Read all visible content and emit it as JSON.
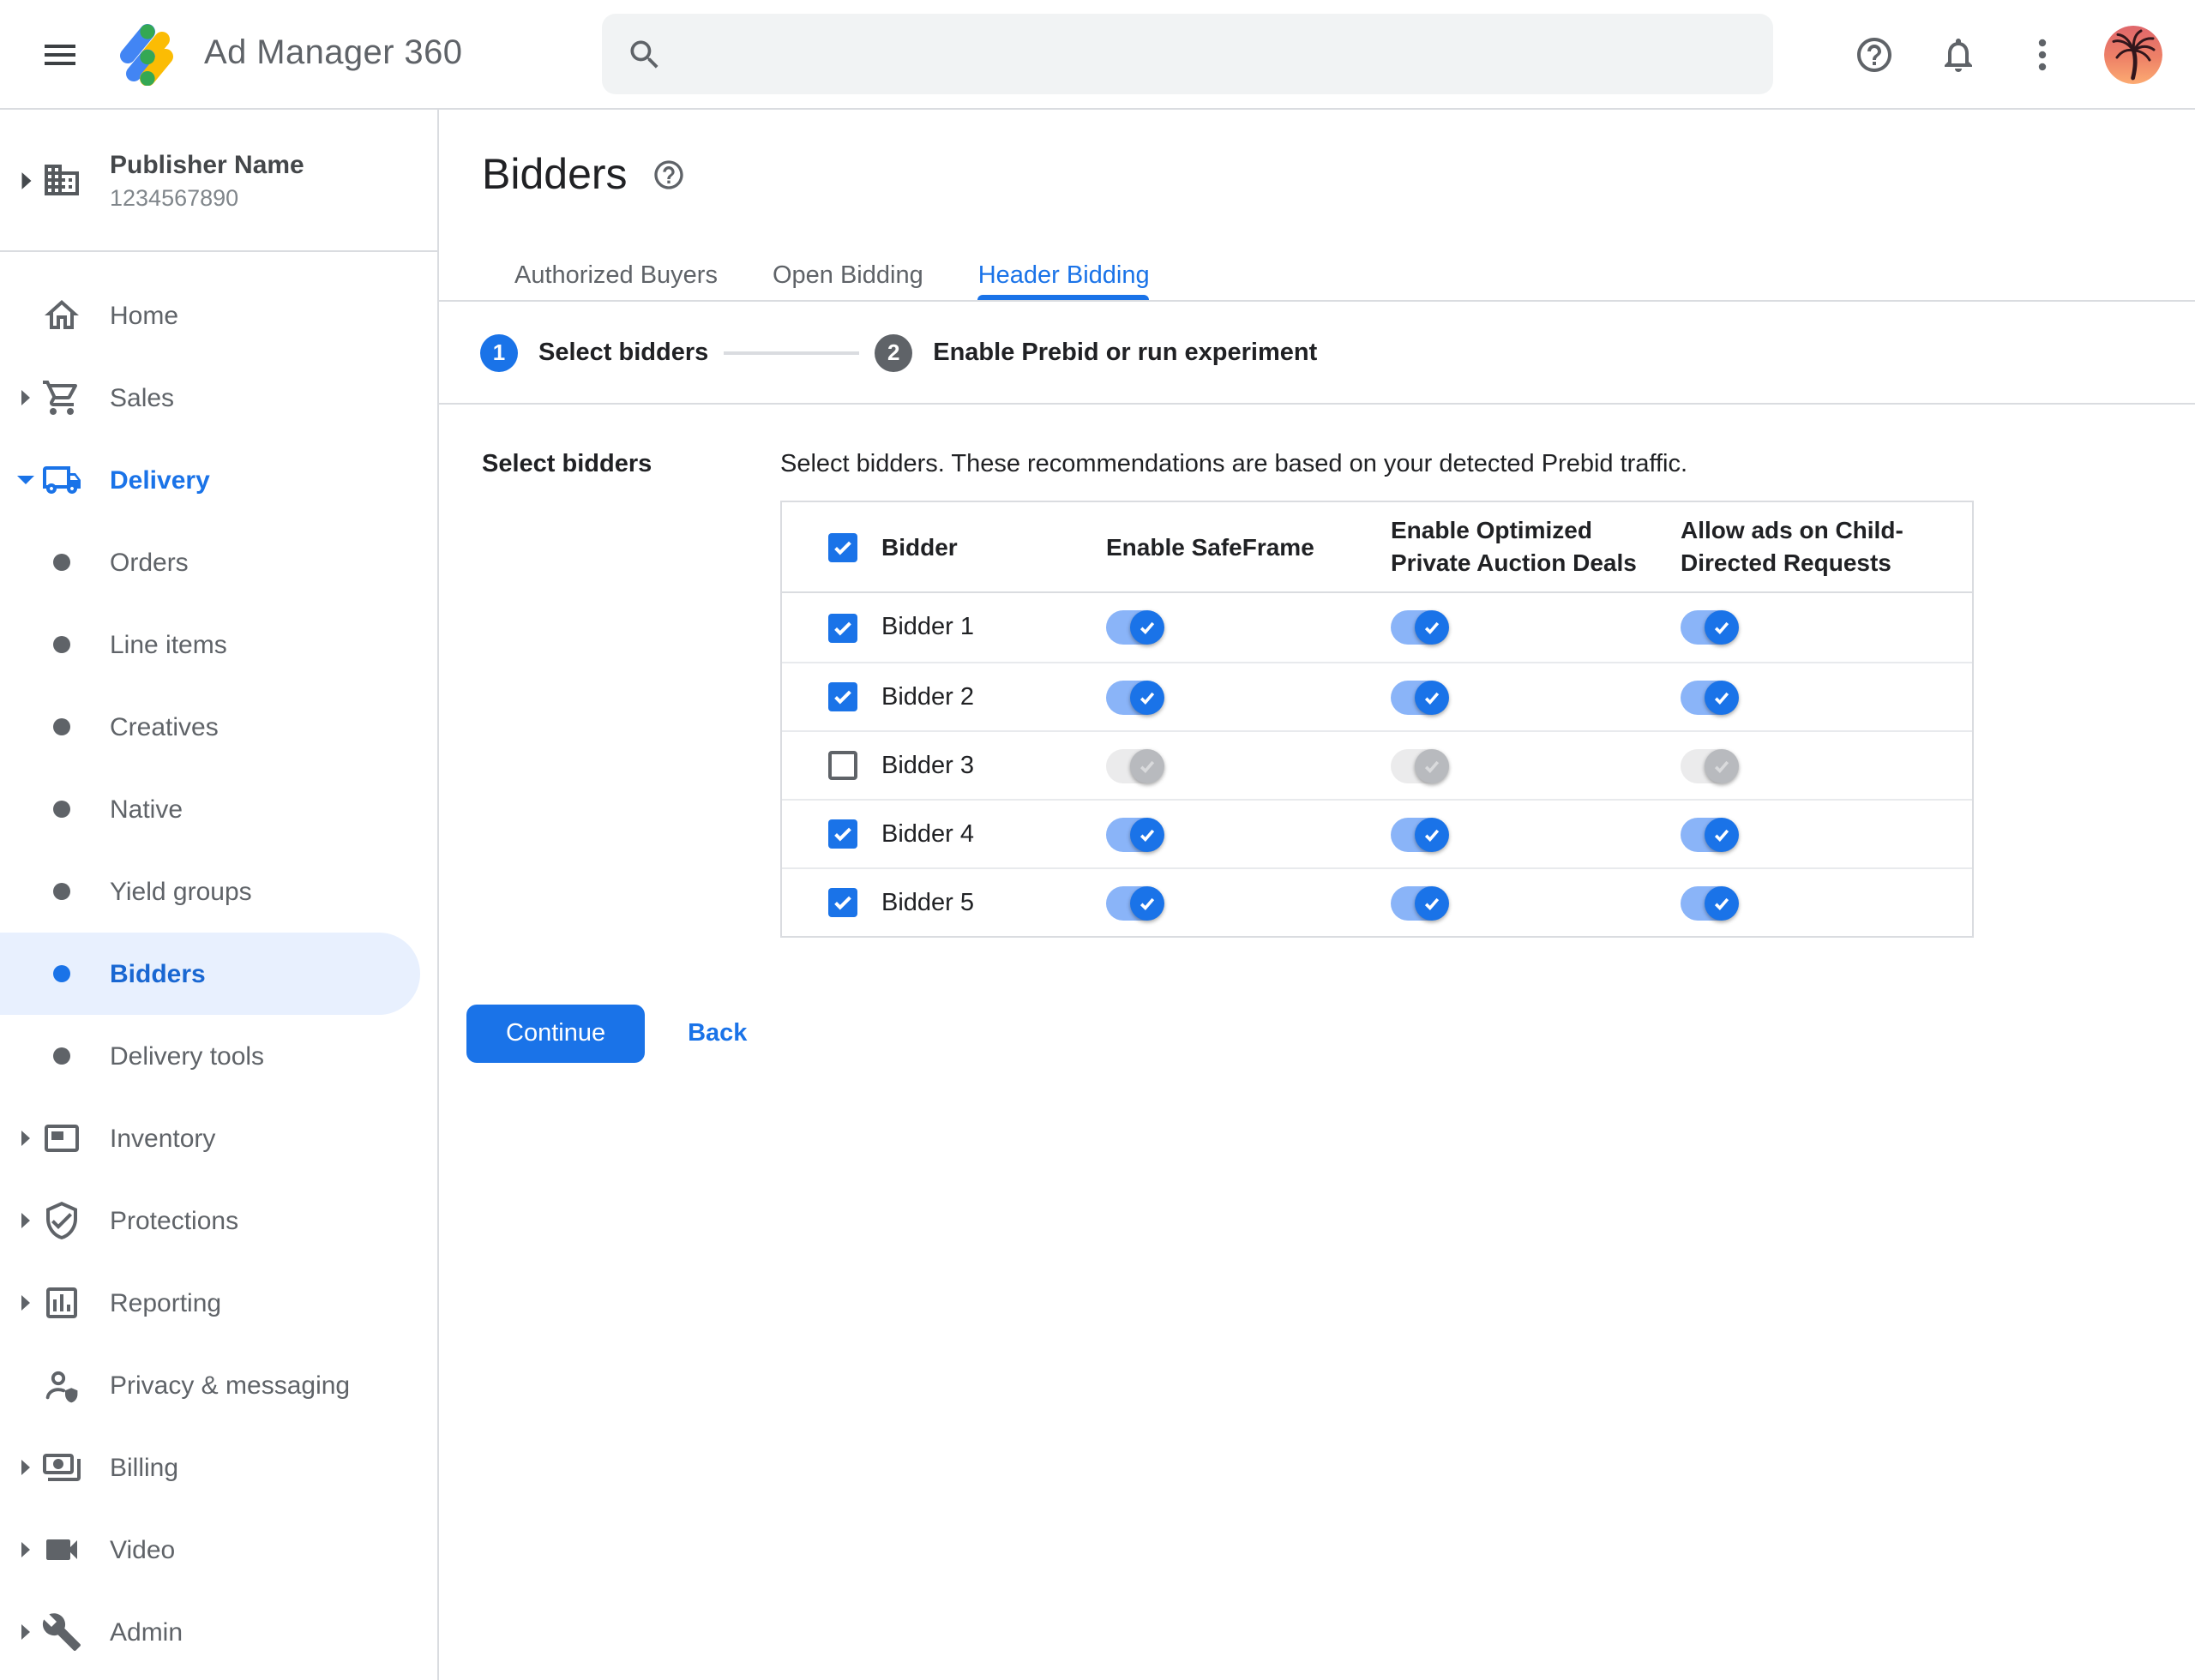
{
  "colors": {
    "accent_blue": "#1a73e8",
    "selected_nav_text": "#1967d2",
    "selected_nav_bg": "#e8f0fe",
    "toggle_on_track": "#8ab4f8",
    "toggle_on_thumb": "#1a73e8",
    "toggle_off_track": "#ebebec",
    "toggle_off_thumb": "#b8babe",
    "divider": "#dadce0",
    "text_primary": "#202124",
    "text_secondary": "#5f6368",
    "logo_blue": "#4285f4",
    "logo_yellow": "#fbbc04",
    "logo_green": "#34a853"
  },
  "header": {
    "brand": "Ad Manager 360",
    "search_placeholder": "",
    "icons": [
      "menu-icon",
      "search-icon",
      "help-icon",
      "notifications-icon",
      "more-vert-icon",
      "avatar"
    ]
  },
  "sidebar": {
    "publisher_name": "Publisher Name",
    "publisher_id": "1234567890",
    "items": [
      {
        "label": "Home",
        "icon": "home-icon"
      },
      {
        "label": "Sales",
        "icon": "cart-icon"
      },
      {
        "label": "Delivery",
        "icon": "truck-icon"
      },
      {
        "label": "Orders",
        "icon": "bullet"
      },
      {
        "label": "Line items",
        "icon": "bullet"
      },
      {
        "label": "Creatives",
        "icon": "bullet"
      },
      {
        "label": "Native",
        "icon": "bullet"
      },
      {
        "label": "Yield groups",
        "icon": "bullet"
      },
      {
        "label": "Bidders",
        "icon": "bullet"
      },
      {
        "label": "Delivery tools",
        "icon": "bullet"
      },
      {
        "label": "Inventory",
        "icon": "ad-unit-icon"
      },
      {
        "label": "Protections",
        "icon": "shield-check-icon"
      },
      {
        "label": "Reporting",
        "icon": "bar-chart-icon"
      },
      {
        "label": "Privacy & messaging",
        "icon": "person-shield-icon"
      },
      {
        "label": "Billing",
        "icon": "payments-icon"
      },
      {
        "label": "Video",
        "icon": "videocam-icon"
      },
      {
        "label": "Admin",
        "icon": "wrench-icon"
      }
    ]
  },
  "main": {
    "title": "Bidders",
    "tabs": [
      {
        "label": "Authorized Buyers",
        "active": false
      },
      {
        "label": "Open Bidding",
        "active": false
      },
      {
        "label": "Header Bidding",
        "active": true
      }
    ],
    "stepper": {
      "step1_number": "1",
      "step1_label": "Select bidders",
      "step2_number": "2",
      "step2_label": "Enable Prebid or run experiment"
    },
    "section_label": "Select bidders",
    "description": "Select bidders. These recommendations are based on your detected Prebid traffic.",
    "table": {
      "header": {
        "select_all_checked": true,
        "col_bidder": "Bidder",
        "col_safeframe": "Enable SafeFrame",
        "col_optimized": "Enable Optimized Private Auction Deals",
        "col_child": "Allow ads on Child-Directed Requests"
      },
      "rows": [
        {
          "name": "Bidder 1",
          "selected": true,
          "safeframe": true,
          "optimized": true,
          "child_directed": true
        },
        {
          "name": "Bidder 2",
          "selected": true,
          "safeframe": true,
          "optimized": true,
          "child_directed": true
        },
        {
          "name": "Bidder 3",
          "selected": false,
          "safeframe": false,
          "optimized": false,
          "child_directed": false
        },
        {
          "name": "Bidder 4",
          "selected": true,
          "safeframe": true,
          "optimized": true,
          "child_directed": true
        },
        {
          "name": "Bidder 5",
          "selected": true,
          "safeframe": true,
          "optimized": true,
          "child_directed": true
        }
      ]
    },
    "continue_label": "Continue",
    "back_label": "Back"
  }
}
